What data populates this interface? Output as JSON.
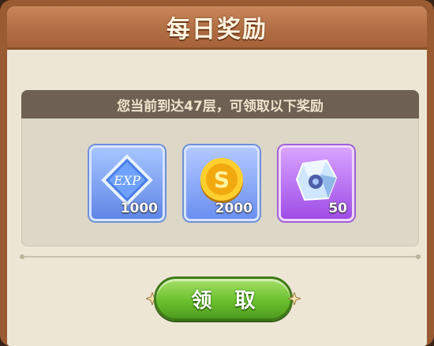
{
  "dialog": {
    "title": "每日奖励",
    "message": "您当前到达47层，可领取以下奖励",
    "rewards": [
      {
        "icon": "exp-crystal-icon",
        "label": "EXP",
        "count": "1000"
      },
      {
        "icon": "gold-coin-icon",
        "label": "S",
        "count": "2000"
      },
      {
        "icon": "crystal-gem-icon",
        "count": "50"
      }
    ],
    "claim_button": "领 取"
  },
  "colors": {
    "frame": "#9a5a32",
    "header": "#b06d43",
    "panel_bar": "#6e6154",
    "button": "#6bc02e"
  }
}
